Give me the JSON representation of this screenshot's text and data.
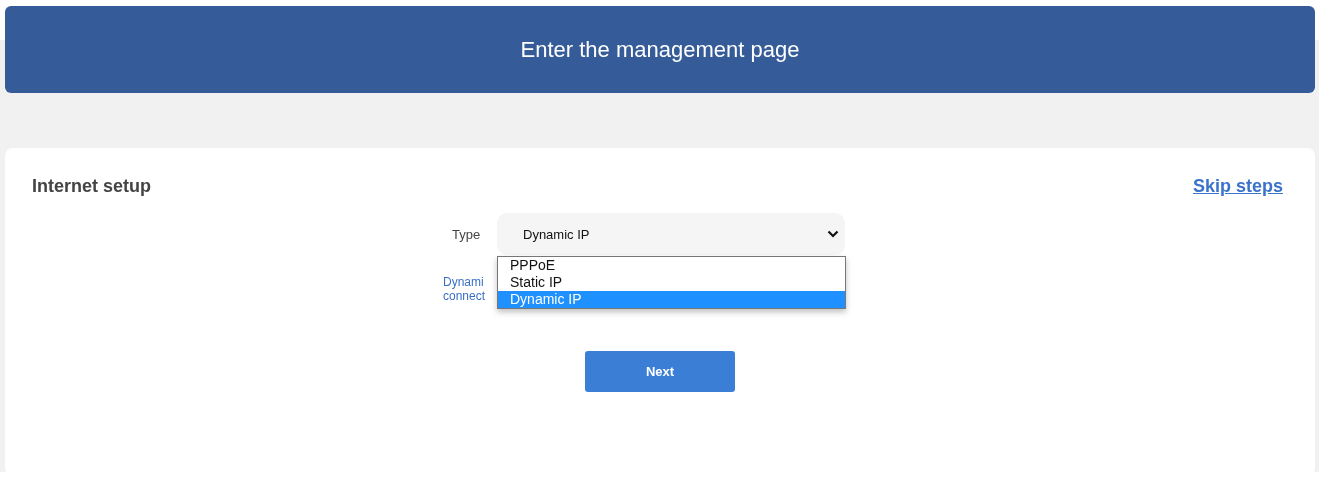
{
  "header": {
    "title": "Enter the management page"
  },
  "section": {
    "title": "Internet setup",
    "skip_link": "Skip steps"
  },
  "type_field": {
    "label": "Type",
    "value": "Dynamic IP",
    "expanded": true,
    "options": [
      {
        "label": "PPPoE",
        "selected": false
      },
      {
        "label": "Static IP",
        "selected": false
      },
      {
        "label": "Dynamic IP",
        "selected": true
      }
    ]
  },
  "description_lines": [
    "Dynami",
    "connect"
  ],
  "next_button": "Next"
}
